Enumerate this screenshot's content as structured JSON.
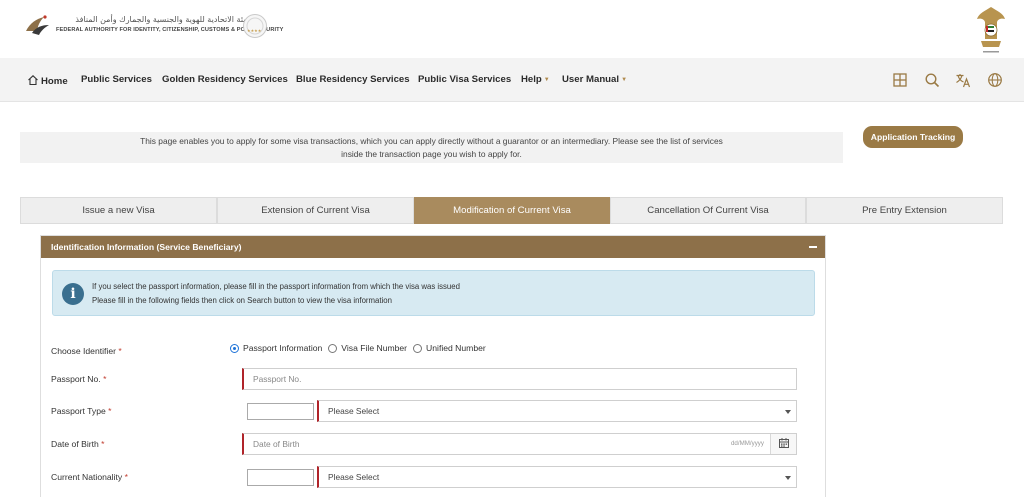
{
  "header": {
    "org_name_ar": "الهيئة الاتحادية للهوية والجنسية والجمارك وأمن المنافذ",
    "org_name_en": "FEDERAL AUTHORITY FOR IDENTITY, CITIZENSHIP, CUSTOMS & PORT SECURITY",
    "logo_icon": "falcon-logo-icon",
    "seal_icon": "star-rating-seal-icon",
    "emblem_icon": "uae-emblem-icon"
  },
  "nav": {
    "items": [
      {
        "label": "Home",
        "icon": "home-icon"
      },
      {
        "label": "Public Services"
      },
      {
        "label": "Golden Residency Services"
      },
      {
        "label": "Blue Residency Services"
      },
      {
        "label": "Public Visa Services"
      },
      {
        "label": "Help",
        "dropdown": true
      },
      {
        "label": "User Manual",
        "dropdown": true
      }
    ],
    "right_icons": [
      "grid-icon",
      "search-icon",
      "translate-icon",
      "globe-icon"
    ]
  },
  "intro": {
    "line1": "This page enables you to apply for some visa transactions, which you can apply directly without a guarantor or an intermediary. Please see the list of services",
    "line2": "inside the transaction page you wish to apply for."
  },
  "tracking_button": "Application Tracking",
  "tabs": [
    {
      "label": "Issue a new Visa",
      "active": false
    },
    {
      "label": "Extension of Current Visa",
      "active": false
    },
    {
      "label": "Modification of Current Visa",
      "active": true
    },
    {
      "label": "Cancellation Of Current Visa",
      "active": false
    },
    {
      "label": "Pre Entry Extension",
      "active": false
    }
  ],
  "panel": {
    "title": "Identification Information (Service Beneficiary)",
    "info_line1": "If you select the passport information, please fill in the passport information from which the visa was issued",
    "info_line2": "Please fill in the following fields then click on Search button to view the visa information"
  },
  "form": {
    "choose_identifier_label": "Choose Identifier",
    "required_mark": "*",
    "identifier_options": [
      {
        "label": "Passport Information",
        "checked": true
      },
      {
        "label": "Visa File Number",
        "checked": false
      },
      {
        "label": "Unified Number",
        "checked": false
      }
    ],
    "passport_no_label": "Passport No.",
    "passport_no_placeholder": "Passport No.",
    "passport_type_label": "Passport Type",
    "passport_type_value": "Please Select",
    "dob_label": "Date of Birth",
    "dob_placeholder": "Date of Birth",
    "dob_format_hint": "dd/MM/yyyy",
    "nationality_label": "Current Nationality",
    "nationality_value": "Please Select"
  },
  "colors": {
    "gold_accent": "#9a7a45",
    "panel_header": "#8d7049",
    "active_tab": "#a98b5e",
    "info_bg": "#d7eaf2",
    "required_bar": "#b0242a"
  }
}
